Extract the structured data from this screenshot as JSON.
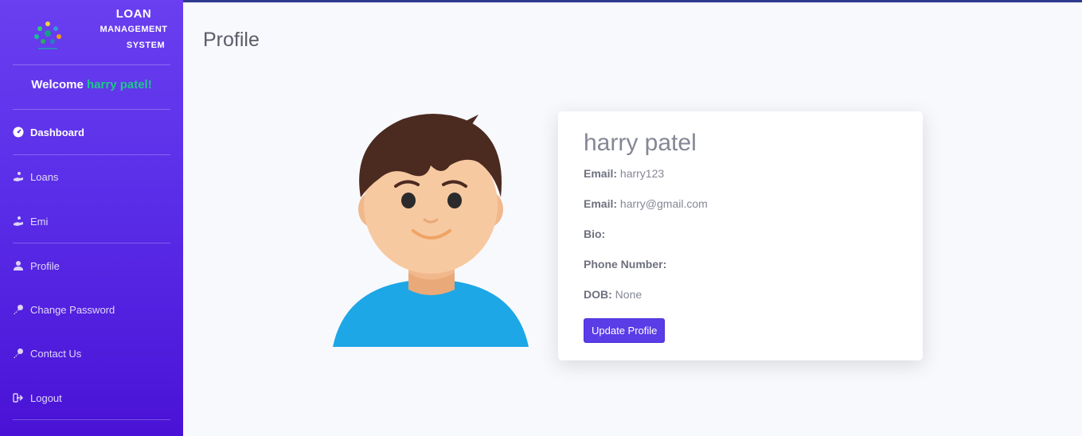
{
  "brand": {
    "line1": "LOAN",
    "line2": "MANAGEMENT",
    "line3": "SYSTEM"
  },
  "welcome": {
    "prefix": "Welcome ",
    "name": "harry patel!"
  },
  "nav": {
    "items": [
      {
        "label": "Dashboard",
        "icon": "tachometer-icon"
      },
      {
        "label": "Loans",
        "icon": "hand-coin-icon"
      },
      {
        "label": "Emi",
        "icon": "hand-coin-icon"
      },
      {
        "label": "Profile",
        "icon": "user-icon"
      },
      {
        "label": "Change Password",
        "icon": "key-icon"
      },
      {
        "label": "Contact Us",
        "icon": "key-icon"
      },
      {
        "label": "Logout",
        "icon": "sign-out-icon"
      }
    ]
  },
  "page": {
    "title": "Profile"
  },
  "profile": {
    "name": "harry patel",
    "username_label": "Email:",
    "username_value": "harry123",
    "email_label": "Email:",
    "email_value": "harry@gmail.com",
    "bio_label": "Bio:",
    "bio_value": "",
    "phone_label": "Phone Number:",
    "phone_value": "",
    "dob_label": "DOB:",
    "dob_value": "None",
    "update_button": "Update Profile"
  },
  "colors": {
    "sidebar_top": "#6a3ff0",
    "sidebar_bottom": "#4a12d6",
    "welcome_name": "#1cc88a",
    "button": "#5a3de6"
  }
}
